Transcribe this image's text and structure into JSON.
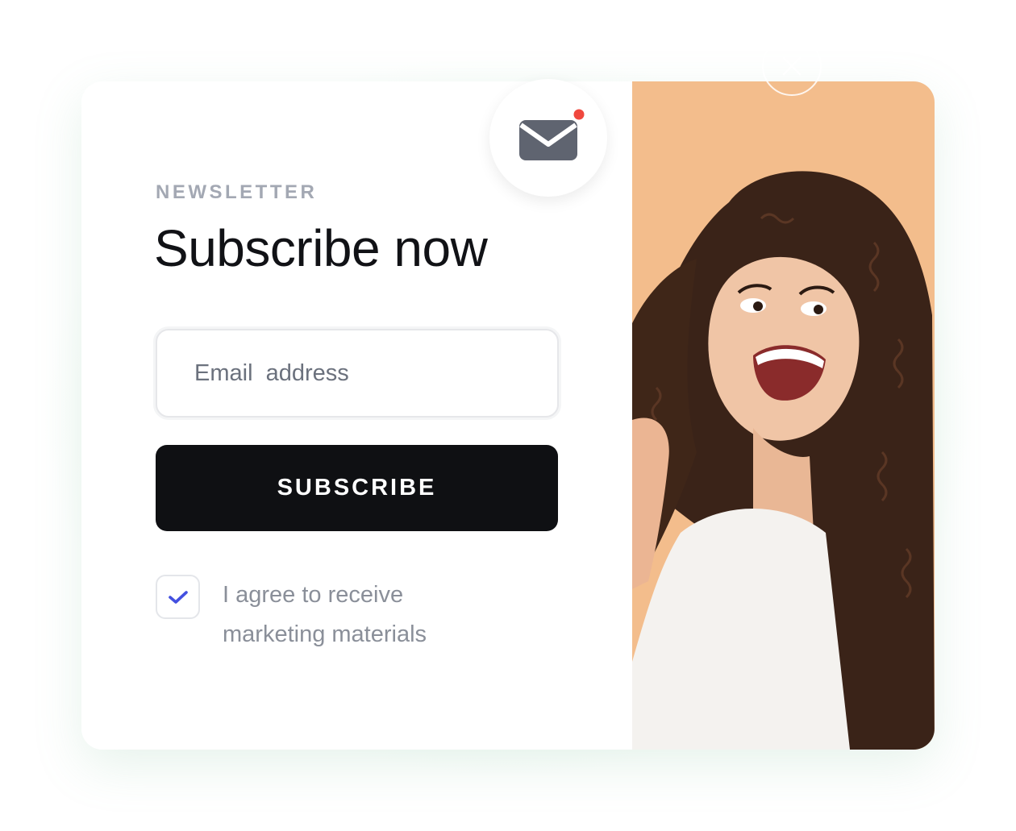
{
  "newsletter": {
    "eyebrow": "NEWSLETTER",
    "title": "Subscribe now",
    "email_placeholder": "Email  address",
    "subscribe_label": "SUBSCRIBE",
    "consent_line1": "I agree to receive",
    "consent_line2": "marketing materials",
    "consent_checked": true
  },
  "icons": {
    "mail": "envelope-icon",
    "notification": "notification-dot-icon",
    "close": "close-icon",
    "check": "checkmark-icon"
  },
  "colors": {
    "button_bg": "#0f1013",
    "photo_bg": "#f3bd8c",
    "check_accent": "#4350e0",
    "notification_dot": "#f0483e",
    "envelope": "#5f6470"
  }
}
